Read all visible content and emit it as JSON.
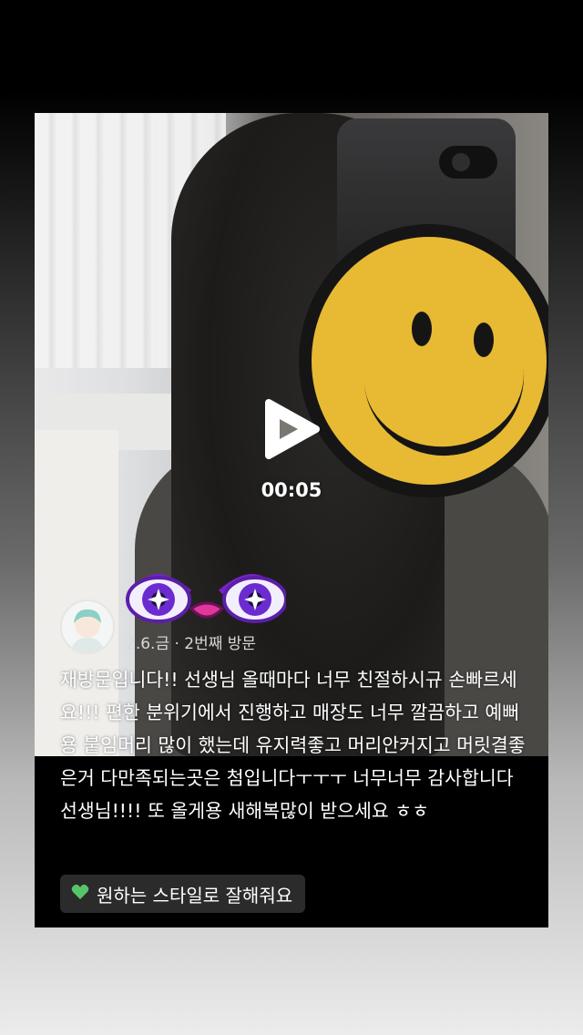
{
  "video": {
    "duration": "00:05"
  },
  "review": {
    "visit_info": "2.6.금 · 2번째 방문",
    "text": "재방문입니다!! 선생님 올때마다 너무 친절하시규 손빠르세요!!! 편한 분위기에서 진행하고 매장도 너무 깔끔하고 예뻐용 붙임머리 많이 했는데 유지력좋고 머리안커지고 머릿결좋은거 다만족되는곳은 첨입니다ㅜㅜㅜ 너무너무 감사합니다 선생님!!!! 또 올게용 새해복많이 받으세요 ㅎㅎ",
    "tag": {
      "icon": "green-heart-icon",
      "label": "원하는 스타일로 잘해줘요"
    }
  },
  "colors": {
    "smiley": "#e8b933",
    "tag_bg": "#2b2b2b",
    "heart": "#58c46a"
  }
}
